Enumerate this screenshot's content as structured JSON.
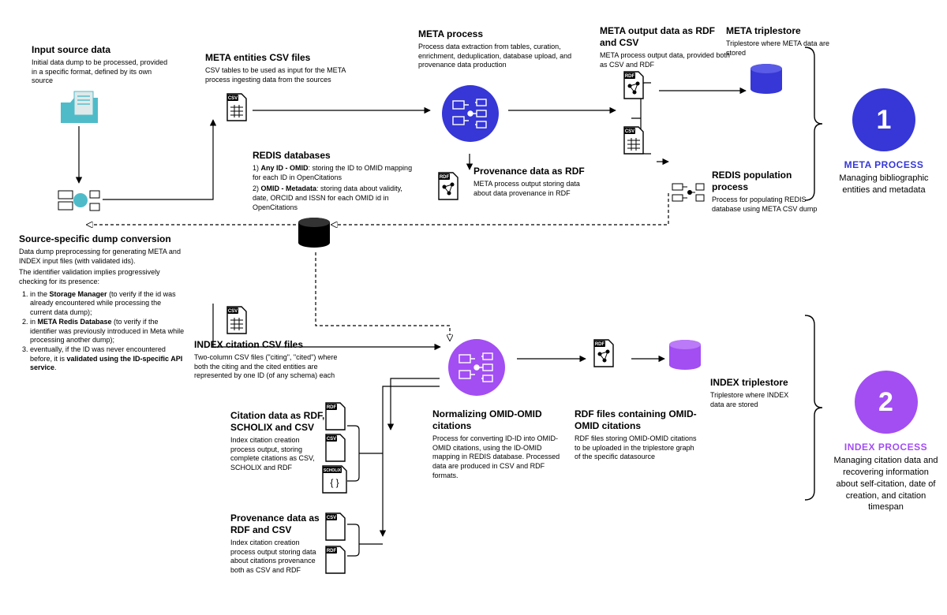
{
  "colors": {
    "meta": "#3637d6",
    "index": "#a24ef3",
    "teal": "#4fbbc9"
  },
  "input": {
    "title": "Input source data",
    "desc": "Initial data dump to be processed, provided in a specific format, defined by its own source"
  },
  "srcconv": {
    "title": "Source-specific dump conversion",
    "intro": "Data dump preprocessing for generating META and INDEX input files (with validated ids).",
    "lead": "The identifier validation implies progressively checking for its presence:",
    "li1": "in the Storage Manager (to verify if the id was already encountered while processing the current data dump);",
    "li1b": "Storage Manager",
    "li2": "in META Redis Database (to verify if the identifier was previously introduced in Meta while processing another dump);",
    "li2b": "META Redis Database",
    "li3": "eventually, if the ID was never encountered before, it is validated using the ID-specific API service.",
    "li3b": "validated using the ID-specific API service"
  },
  "meta_csv": {
    "title": "META entities CSV files",
    "desc": "CSV tables to be used as input for the META process ingesting data from the sources"
  },
  "redis": {
    "title": "REDIS databases",
    "l1": "1) Any ID - OMID: storing the ID to OMID mapping for each ID in OpenCitations",
    "l1b": "Any ID - OMID",
    "l2": "2) OMID - Metadata: storing data about validity, date, ORCID and ISSN for each OMID id in OpenCitations",
    "l2b": "OMID - Metadata"
  },
  "meta_proc": {
    "title": "META process",
    "desc": "Process data extraction from tables, curation, enrichment, deduplication, database upload, and provenance data production"
  },
  "prov_rdf": {
    "title": "Provenance data as RDF",
    "desc": "META process output storing data about data provenance in RDF"
  },
  "meta_out": {
    "title": "META output data as RDF and CSV",
    "desc": "META process output data, provided both as CSV and RDF"
  },
  "meta_ts": {
    "title": "META triplestore",
    "desc": "Triplestore where META data are stored"
  },
  "redis_pop": {
    "title": "REDIS population process",
    "desc": "Process for populating REDIS database using META CSV dump"
  },
  "idx_csv": {
    "title": "INDEX citation CSV files",
    "desc": "Two-column CSV files (\"citing\", \"cited\") where both the citing and the cited entities are represented by one ID (of any schema) each"
  },
  "norm": {
    "title": "Normalizing OMID-OMID citations",
    "desc": "Process for converting ID-ID into OMID-OMID citations, using the ID-OMID mapping in REDIS database. Processed data are produced in CSV and RDF formats."
  },
  "cit_out": {
    "title": "Citation data as RDF, SCHOLIX and CSV",
    "desc": "Index citation creation process output, storing complete citations  as CSV, SCHOLIX  and RDF"
  },
  "prov_out": {
    "title": "Provenance data as RDF and CSV",
    "desc": "Index citation creation process output storing data about citations provenance both as CSV and RDF"
  },
  "rdf_omid": {
    "title": "RDF files containing OMID-OMID citations",
    "desc": "RDF files storing OMID-OMID citations to be uploaded in the triplestore graph of the specific datasource"
  },
  "idx_ts": {
    "title": "INDEX triplestore",
    "desc": "Triplestore where INDEX data are stored"
  },
  "side": {
    "n1": "1",
    "lbl1": "META PROCESS",
    "sub1": "Managing bibliographic entities and metadata",
    "n2": "2",
    "lbl2": "INDEX PROCESS",
    "sub2": "Managing citation data and recovering information about self-citation, date of creation, and citation timespan"
  },
  "tags": {
    "csv": "CSV",
    "rdf": "RDF",
    "scholix": "SCHOLIX"
  }
}
